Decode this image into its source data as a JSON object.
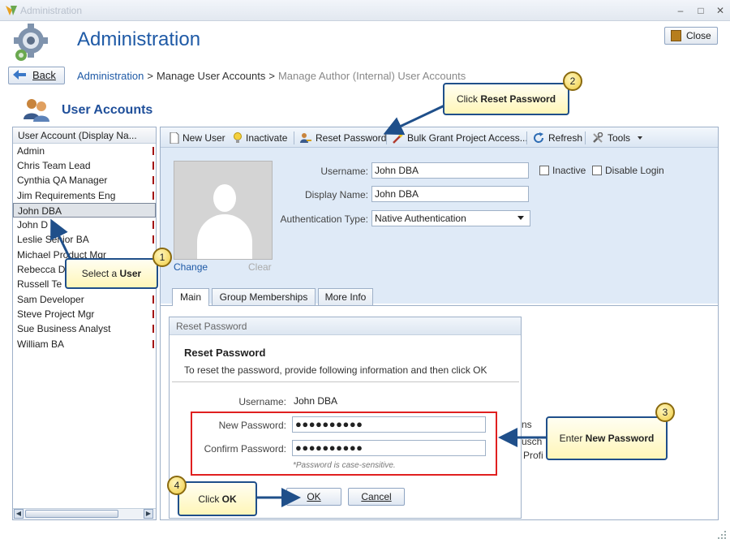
{
  "window": {
    "title": "Administration"
  },
  "header": {
    "title": "Administration",
    "close_label": "Close",
    "back_label": "Back",
    "breadcrumb": {
      "root": "Administration",
      "manage": "Manage User Accounts",
      "current": "Manage Author (Internal) User Accounts"
    }
  },
  "section": {
    "title": "User Accounts"
  },
  "user_list": {
    "header": "User Account (Display Na...",
    "items": [
      "Admin",
      "Chris Team Lead",
      "Cynthia QA Manager",
      "Jim Requirements Eng",
      "John DBA",
      "John D",
      "Leslie Senior BA",
      "Michael Product Mgr",
      "Rebecca D",
      "Russell Te",
      "Sam Developer",
      "Steve Project Mgr",
      "Sue Business Analyst",
      "William BA"
    ],
    "selected": "John DBA"
  },
  "toolbar": {
    "new_user": "New User",
    "inactivate": "Inactivate",
    "reset_password": "Reset Password",
    "bulk_grant": "Bulk Grant Project Access...",
    "refresh": "Refresh",
    "tools": "Tools"
  },
  "profile": {
    "change_label": "Change",
    "clear_label": "Clear",
    "username_label": "Username:",
    "username": "John DBA",
    "display_name_label": "Display Name:",
    "display_name": "John DBA",
    "auth_type_label": "Authentication Type:",
    "auth_type": "Native Authentication",
    "inactive_label": "Inactive",
    "disable_login_label": "Disable Login"
  },
  "tabs": [
    "Main",
    "Group Memberships",
    "More Info"
  ],
  "dialog": {
    "title": "Reset Password",
    "heading": "Reset Password",
    "description": "To reset the password, provide following information and then click OK",
    "username_label": "Username:",
    "username": "John DBA",
    "new_password_label": "New Password:",
    "new_password": "●●●●●●●●●●",
    "confirm_password_label": "Confirm Password:",
    "confirm_password": "●●●●●●●●●●",
    "hint": "*Password is case-sensitive.",
    "ok_label": "OK",
    "cancel_label": "Cancel"
  },
  "background_fragments": {
    "ns": "ns",
    "usch": "usch",
    "profi": "Profi"
  },
  "callouts": [
    {
      "number": "1",
      "text": "Select a ",
      "bold": "User"
    },
    {
      "number": "2",
      "text": "Click ",
      "bold": "Reset Password"
    },
    {
      "number": "3",
      "text": "Enter ",
      "bold": "New Password"
    },
    {
      "number": "4",
      "text": "Click ",
      "bold": "OK"
    }
  ],
  "colors": {
    "accent": "#1f5aa6",
    "callout_border": "#1f4f8a",
    "highlight_red": "#e02020",
    "callout_fill": "#fff6b8"
  }
}
